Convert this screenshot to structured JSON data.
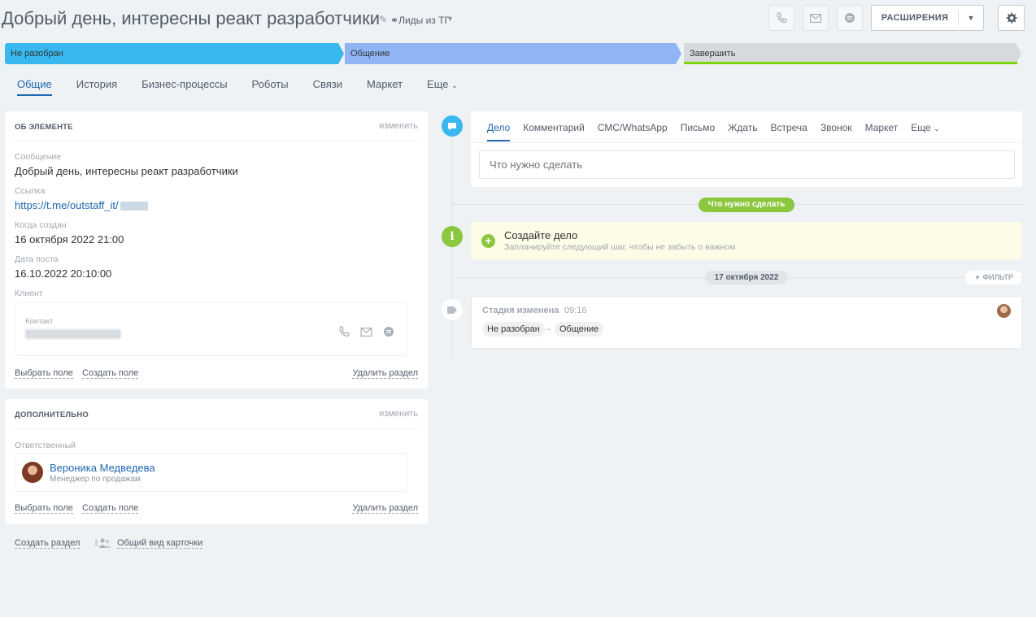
{
  "header": {
    "title": "Добрый день, интересны реакт разработчики",
    "category": "Лиды из ТГ",
    "extensions_label": "РАСШИРЕНИЯ"
  },
  "stages": [
    {
      "label": "Не разобран",
      "color": "#39b8ef"
    },
    {
      "label": "Общение",
      "color": "#8fb5f5"
    },
    {
      "label": "Завершить",
      "color": "#d6dadc"
    }
  ],
  "tabs": [
    "Общие",
    "История",
    "Бизнес-процессы",
    "Роботы",
    "Связи",
    "Маркет",
    "Еще"
  ],
  "about": {
    "title": "ОБ ЭЛЕМЕНТЕ",
    "change": "изменить",
    "fields": [
      {
        "label": "Сообщение",
        "value": "Добрый день, интересны реакт разработчики"
      },
      {
        "label": "Ссылка",
        "value": "https://t.me/outstaff_it/"
      },
      {
        "label": "Когда создан",
        "value": "16 октября 2022 21:00"
      },
      {
        "label": "Дата поста",
        "value": "16.10.2022 20:10:00"
      }
    ],
    "client_label": "Клиент",
    "contact_label": "Контакт",
    "select_field": "Выбрать поле",
    "create_field": "Создать поле",
    "delete_section": "Удалить раздел"
  },
  "additional": {
    "title": "ДОПОЛНИТЕЛЬНО",
    "change": "изменить",
    "responsible_label": "Ответственный",
    "responsible_name": "Вероника Медведева",
    "responsible_position": "Менеджер по продажам",
    "select_field": "Выбрать поле",
    "create_field": "Создать поле",
    "delete_section": "Удалить раздел"
  },
  "footer": {
    "create_section": "Создать раздел",
    "card_view": "Общий вид карточки"
  },
  "composer": {
    "tabs": [
      "Дело",
      "Комментарий",
      "СМС/WhatsApp",
      "Письмо",
      "Ждать",
      "Встреча",
      "Звонок",
      "Маркет",
      "Еще"
    ],
    "placeholder": "Что нужно сделать"
  },
  "timeline": {
    "todo_pill": "Что нужно сделать",
    "todo_title": "Создайте дело",
    "todo_subtitle": "Запланируйте следующий шаг, чтобы не забыть о важном",
    "date_pill": "17 октября 2022",
    "filter": "ФИЛЬТР",
    "event_title": "Стадия изменена",
    "event_time": "09:16",
    "event_from": "Не разобран",
    "event_to": "Общение"
  },
  "colors": {
    "accent": "#2067b0",
    "success": "#8dc63f",
    "stage_done_line": "#7bd500"
  }
}
